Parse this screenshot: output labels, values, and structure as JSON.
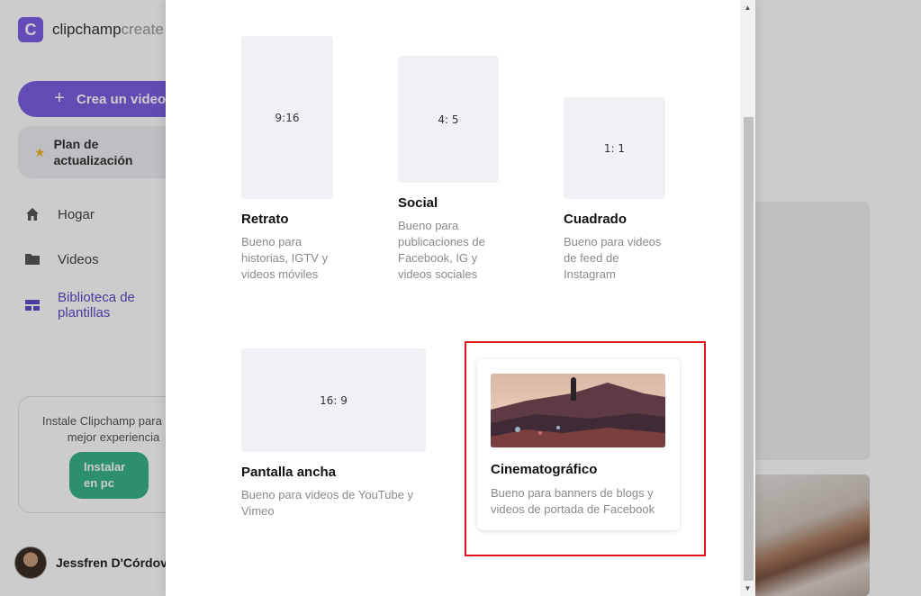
{
  "app": {
    "logo_letter": "C",
    "logo_name": "clipchamp",
    "logo_suffix": "create",
    "create_button": "Crea un video",
    "upgrade_button": "Plan de actualización",
    "nav": [
      {
        "label": "Hogar",
        "icon": "home-icon"
      },
      {
        "label": "Videos",
        "icon": "folder-icon"
      },
      {
        "label": "Biblioteca de plantillas",
        "icon": "template-icon"
      }
    ],
    "install_text": "Instale Clipchamp para una mejor experiencia",
    "install_button": "Instalar en pc",
    "user_name": "Jessfren D'Córdova",
    "accent_color": "#7b5fe0",
    "install_color": "#3ab28c"
  },
  "modal": {
    "formats": [
      {
        "ratio": "9:16",
        "title": "Retrato",
        "description": "Bueno para historias, IGTV y videos móviles"
      },
      {
        "ratio": "4: 5",
        "title": "Social",
        "description": "Bueno para publicaciones de Facebook, IG y videos sociales"
      },
      {
        "ratio": "1: 1",
        "title": "Cuadrado",
        "description": "Bueno para videos de feed de Instagram"
      },
      {
        "ratio": "16: 9",
        "title": "Pantalla ancha",
        "description": "Bueno para videos de YouTube y Vimeo"
      },
      {
        "ratio": "",
        "title": "Cinematográfico",
        "description": "Bueno para banners de blogs y videos de portada de Facebook"
      }
    ],
    "highlight_color": "#e0141e"
  }
}
